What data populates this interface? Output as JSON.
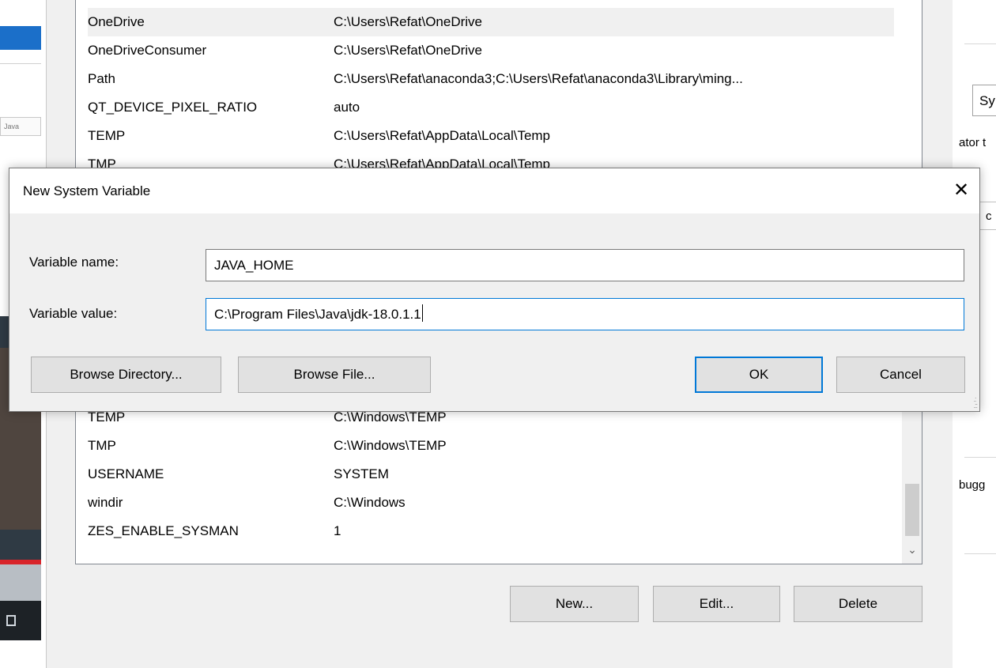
{
  "user_vars": [
    {
      "name": "OneDrive",
      "value": "C:\\Users\\Refat\\OneDrive",
      "selected": true
    },
    {
      "name": "OneDriveConsumer",
      "value": "C:\\Users\\Refat\\OneDrive"
    },
    {
      "name": "Path",
      "value": "C:\\Users\\Refat\\anaconda3;C:\\Users\\Refat\\anaconda3\\Library\\ming..."
    },
    {
      "name": "QT_DEVICE_PIXEL_RATIO",
      "value": "auto"
    },
    {
      "name": "TEMP",
      "value": "C:\\Users\\Refat\\AppData\\Local\\Temp"
    },
    {
      "name": "TMP",
      "value": "C:\\Users\\Refat\\AppData\\Local\\Temp"
    }
  ],
  "system_vars": [
    {
      "name": "TEMP",
      "value": "C:\\Windows\\TEMP"
    },
    {
      "name": "TMP",
      "value": "C:\\Windows\\TEMP"
    },
    {
      "name": "USERNAME",
      "value": "SYSTEM"
    },
    {
      "name": "windir",
      "value": "C:\\Windows"
    },
    {
      "name": "ZES_ENABLE_SYSMAN",
      "value": "1"
    }
  ],
  "panel_buttons": {
    "new": "New...",
    "edit": "Edit...",
    "delete": "Delete"
  },
  "background_right": {
    "tab": "Sy",
    "text1": "ator t",
    "box1": "c",
    "text2": "bugg"
  },
  "background_left": {
    "tab": "Java"
  },
  "dialog": {
    "title": "New System Variable",
    "close_glyph": "✕",
    "name_label": "Variable name:",
    "name_value": "JAVA_HOME",
    "value_label": "Variable value:",
    "value_value": "C:\\Program Files\\Java\\jdk-18.0.1.1",
    "buttons": {
      "browse_directory": "Browse Directory...",
      "browse_file": "Browse File...",
      "ok": "OK",
      "cancel": "Cancel"
    }
  }
}
